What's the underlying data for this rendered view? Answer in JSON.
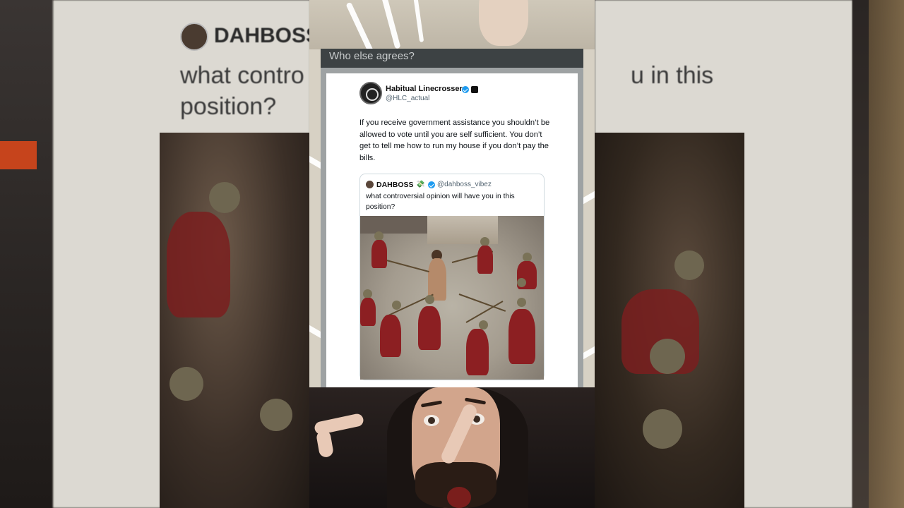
{
  "caption": "Who else agrees?",
  "tweet": {
    "author_name": "Habitual Linecrosser",
    "author_handle": "@HLC_actual",
    "body": "If you receive government assistance you shouldn’t be allowed to vote until you are self sufficient. You don’t get to tell me how to run my house if you don’t pay the bills."
  },
  "quoted": {
    "author_name": "DAHBOSS",
    "author_emoji": "💸",
    "author_handle": "@dahboss_vibez",
    "body": "what controversial opinion will have you in this position?"
  },
  "background": {
    "name": "DAHBOSS",
    "text_line1_left": "what contro",
    "text_line1_right": "u in this",
    "text_line2": "position?"
  },
  "colors": {
    "verified": "#1d9bf0",
    "caption_bar": "#3d4244",
    "caption_text": "#c9cccd"
  }
}
